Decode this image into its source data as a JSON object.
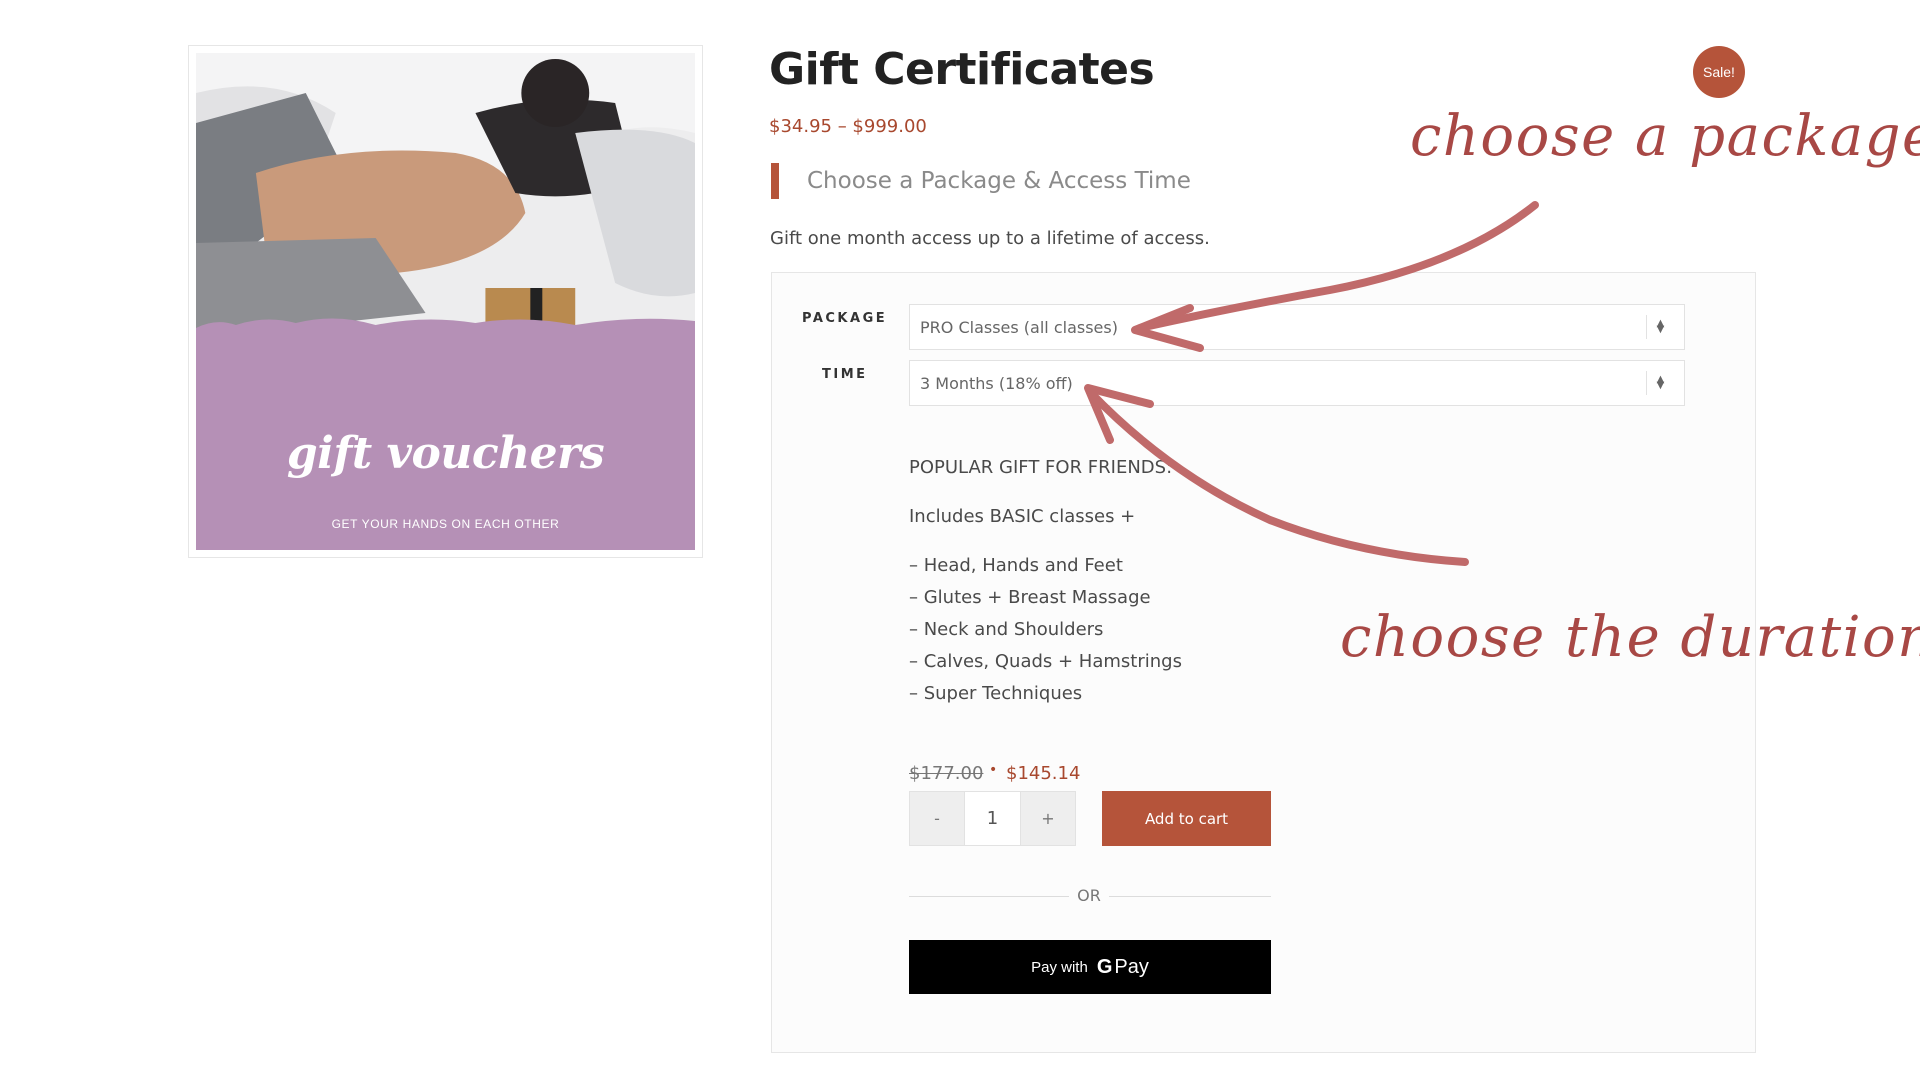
{
  "product": {
    "title": "Gift Certificates",
    "sale_badge": "Sale!",
    "price_range": "$34.95 – $999.00",
    "section_heading": "Choose a Package & Access Time",
    "short_description": "Gift one month access up to a lifetime of access."
  },
  "image": {
    "title": "gift vouchers",
    "subtitle": "GET YOUR HANDS ON EACH OTHER"
  },
  "variations": {
    "package": {
      "label": "PACKAGE",
      "value": "PRO Classes (all classes)"
    },
    "time": {
      "label": "TIME",
      "value": "3 Months (18% off)"
    }
  },
  "variation_description": {
    "heading": "POPULAR GIFT FOR FRIENDS:",
    "intro": "Includes BASIC classes +",
    "items": [
      "– Head, Hands and Feet",
      "– Glutes + Breast Massage",
      "– Neck and Shoulders",
      "– Calves, Quads + Hamstrings",
      "– Super Techniques"
    ]
  },
  "pricing": {
    "old_price": "$177.00",
    "new_price": "$145.14"
  },
  "cart": {
    "minus": "-",
    "quantity": "1",
    "plus": "+",
    "add_to_cart": "Add to cart",
    "or": "OR",
    "gpay_prefix": "Pay with",
    "gpay_g": "G",
    "gpay_pay": "Pay"
  },
  "annotations": {
    "package_note": "choose a package",
    "duration_note": "choose the duration"
  },
  "colors": {
    "accent": "#b5543a",
    "price": "#a8482e",
    "voucher_bg": "#b590b6",
    "annotation": "#a84845",
    "arrow": "#c06a6a"
  }
}
